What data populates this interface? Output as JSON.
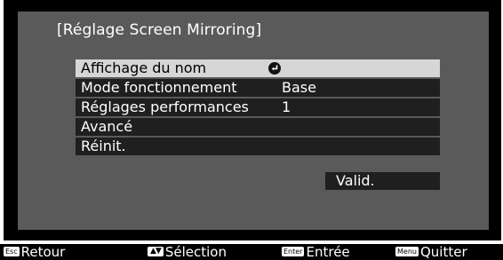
{
  "title": "[Réglage Screen Mirroring]",
  "menu": {
    "items": [
      {
        "label": "Affichage du nom",
        "value": "",
        "icon": "enter-return-icon",
        "selected": true
      },
      {
        "label": "Mode fonctionnement",
        "value": "Base"
      },
      {
        "label": "Réglages performances",
        "value": "1"
      },
      {
        "label": "Avancé",
        "value": ""
      },
      {
        "label": "Réinit.",
        "value": ""
      }
    ]
  },
  "valid_button": {
    "label": "Valid."
  },
  "footer": {
    "items": [
      {
        "key": "Esc",
        "label": "Retour"
      },
      {
        "key": "▲▼",
        "label": "Sélection"
      },
      {
        "key": "Enter",
        "label": "Entrée"
      },
      {
        "key": "Menu",
        "label": "Quitter"
      }
    ]
  },
  "colors": {
    "background": "#000000",
    "panel": "#5a5a5a",
    "row": "#1f1f1f",
    "selected_row": "#d6d6d6",
    "text": "#ffffff"
  }
}
